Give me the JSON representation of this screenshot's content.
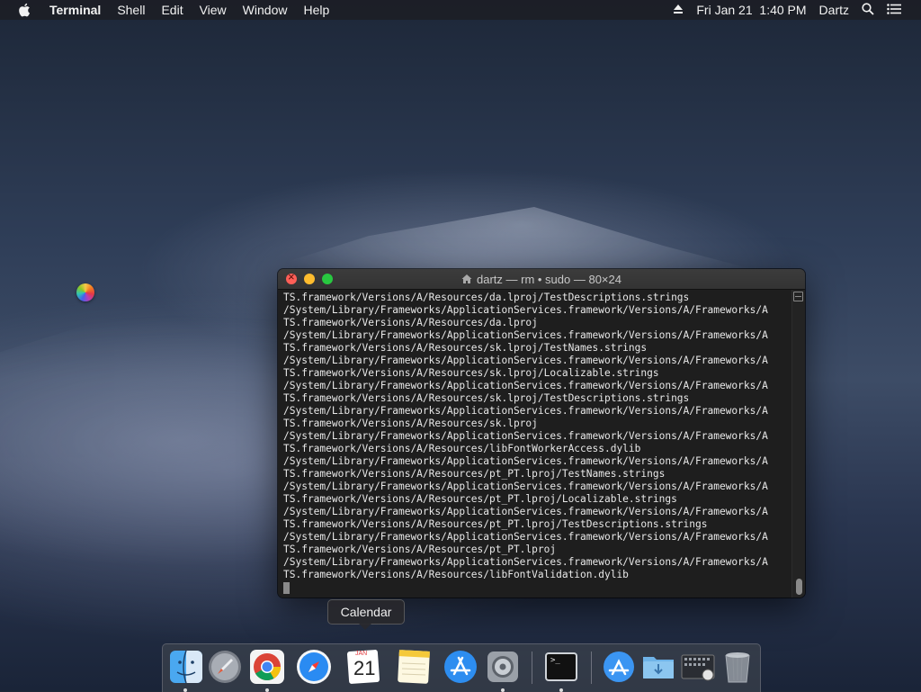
{
  "menubar": {
    "app_name": "Terminal",
    "menus": [
      "Shell",
      "Edit",
      "View",
      "Window",
      "Help"
    ],
    "datetime": "Fri Jan 21  1:40 PM",
    "user": "Dartz"
  },
  "window": {
    "title": "dartz — rm • sudo — 80×24",
    "lines": [
      "TS.framework/Versions/A/Resources/da.lproj/TestDescriptions.strings",
      "/System/Library/Frameworks/ApplicationServices.framework/Versions/A/Frameworks/A",
      "TS.framework/Versions/A/Resources/da.lproj",
      "/System/Library/Frameworks/ApplicationServices.framework/Versions/A/Frameworks/A",
      "TS.framework/Versions/A/Resources/sk.lproj/TestNames.strings",
      "/System/Library/Frameworks/ApplicationServices.framework/Versions/A/Frameworks/A",
      "TS.framework/Versions/A/Resources/sk.lproj/Localizable.strings",
      "/System/Library/Frameworks/ApplicationServices.framework/Versions/A/Frameworks/A",
      "TS.framework/Versions/A/Resources/sk.lproj/TestDescriptions.strings",
      "/System/Library/Frameworks/ApplicationServices.framework/Versions/A/Frameworks/A",
      "TS.framework/Versions/A/Resources/sk.lproj",
      "/System/Library/Frameworks/ApplicationServices.framework/Versions/A/Frameworks/A",
      "TS.framework/Versions/A/Resources/libFontWorkerAccess.dylib",
      "/System/Library/Frameworks/ApplicationServices.framework/Versions/A/Frameworks/A",
      "TS.framework/Versions/A/Resources/pt_PT.lproj/TestNames.strings",
      "/System/Library/Frameworks/ApplicationServices.framework/Versions/A/Frameworks/A",
      "TS.framework/Versions/A/Resources/pt_PT.lproj/Localizable.strings",
      "/System/Library/Frameworks/ApplicationServices.framework/Versions/A/Frameworks/A",
      "TS.framework/Versions/A/Resources/pt_PT.lproj/TestDescriptions.strings",
      "/System/Library/Frameworks/ApplicationServices.framework/Versions/A/Frameworks/A",
      "TS.framework/Versions/A/Resources/pt_PT.lproj",
      "/System/Library/Frameworks/ApplicationServices.framework/Versions/A/Frameworks/A",
      "TS.framework/Versions/A/Resources/libFontValidation.dylib"
    ]
  },
  "tooltip": {
    "label": "Calendar"
  },
  "dock": {
    "calendar_month": "JAN",
    "calendar_day": "21",
    "terminal_prompt": ">_"
  },
  "colors": {
    "close": "#fe5f57",
    "minimize": "#febc2e",
    "maximize": "#28c840",
    "terminal_bg": "#1e1e1e",
    "terminal_fg": "#e8e8e8"
  }
}
